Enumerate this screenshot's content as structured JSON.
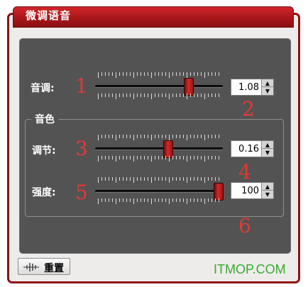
{
  "window": {
    "title": "微调语音"
  },
  "sliders": [
    {
      "id": "pitch",
      "label": "音调:",
      "value": "1.08",
      "level": 0.75,
      "marker_top": "1",
      "marker_value": "2"
    },
    {
      "id": "adjust",
      "label": "调节:",
      "value": "0.16",
      "level": 0.58,
      "marker_top": "3",
      "marker_value": "4"
    },
    {
      "id": "intensity",
      "label": "强度:",
      "value": "100",
      "level": 1.0,
      "marker_top": "5",
      "marker_value": "6"
    }
  ],
  "timbre_group": {
    "label": "音色"
  },
  "reset_button": {
    "label": "重置",
    "icon": "waveform-icon"
  },
  "watermark": "ITMOP.COM",
  "colors": {
    "title_bar": "#b81c20",
    "panel": "#535353",
    "thumb": "#c42024",
    "marker": "#e23a35",
    "watermark": "#3aa832"
  }
}
